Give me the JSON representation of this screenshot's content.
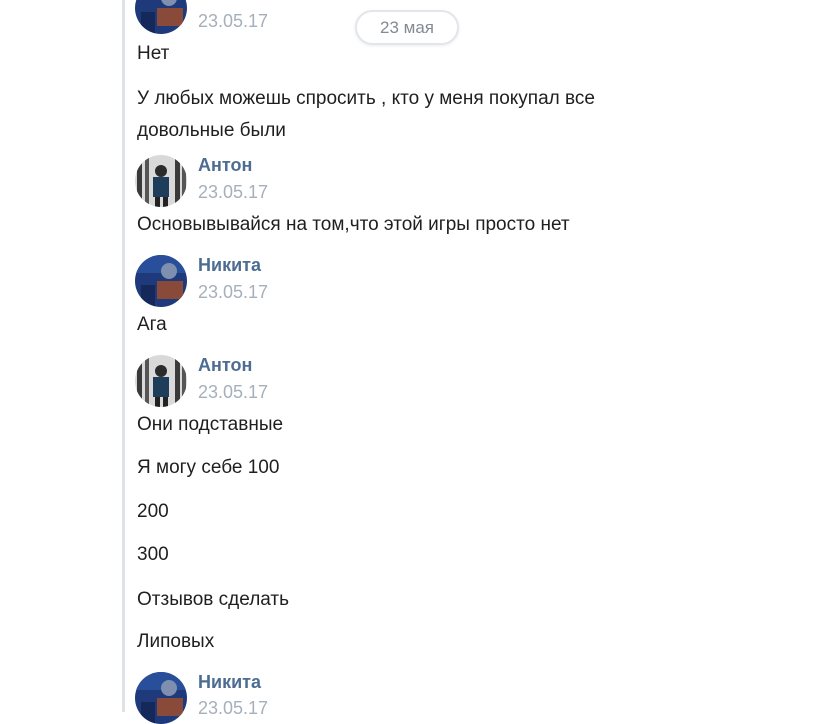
{
  "date_separator": "23 мая",
  "messages": [
    {
      "author": "",
      "avatar": "nikita",
      "time": "23.05.17",
      "lines": [
        "Нет",
        "У любых можешь спросить , кто у меня покупал все довольные были"
      ]
    },
    {
      "author": "Антон",
      "avatar": "anton",
      "time": "23.05.17",
      "lines": [
        "Основывывайся на том,что этой игры просто нет"
      ]
    },
    {
      "author": "Никита",
      "avatar": "nikita",
      "time": "23.05.17",
      "lines": [
        "Ага"
      ]
    },
    {
      "author": "Антон",
      "avatar": "anton",
      "time": "23.05.17",
      "lines": [
        "Они подставные",
        "Я могу себе 100",
        "200",
        "300",
        "Отзывов сделать",
        "Липовых"
      ]
    },
    {
      "author": "Никита",
      "avatar": "nikita",
      "time": "23.05.17",
      "lines": []
    }
  ],
  "colors": {
    "author": "#4d6c91",
    "time": "#a6b0bb",
    "text": "#1f1f1f",
    "border": "#dfe3e8"
  }
}
